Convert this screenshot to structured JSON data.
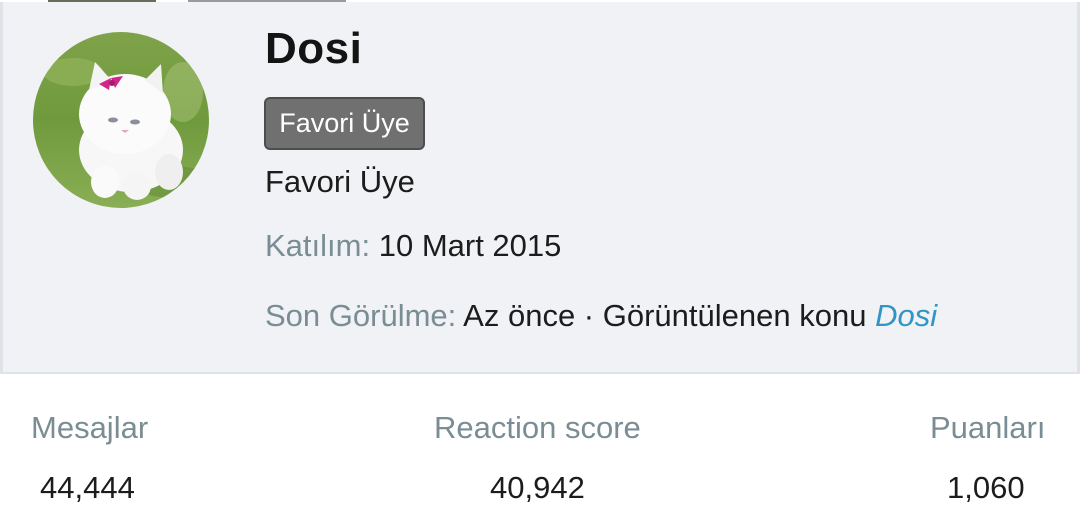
{
  "profile": {
    "username": "Dosi",
    "badge": "Favori Üye",
    "user_title": "Favori Üye",
    "joined_label": "Katılım:",
    "joined_value": "10 Mart 2015",
    "last_seen_label": "Son Görülme:",
    "last_seen_value": "Az önce · Görüntülenen konu",
    "last_seen_link": "Dosi",
    "avatar_icon": "white-kitten-avatar"
  },
  "stats": [
    {
      "label": "Mesajlar",
      "value": "44,444"
    },
    {
      "label": "Reaction score",
      "value": "40,942"
    },
    {
      "label": "Puanları",
      "value": "1,060"
    }
  ],
  "colors": {
    "card_background": "#f0f2f5",
    "badge_background": "#707070",
    "label_gray": "#7a8d94",
    "link_blue": "#2f95c7"
  }
}
